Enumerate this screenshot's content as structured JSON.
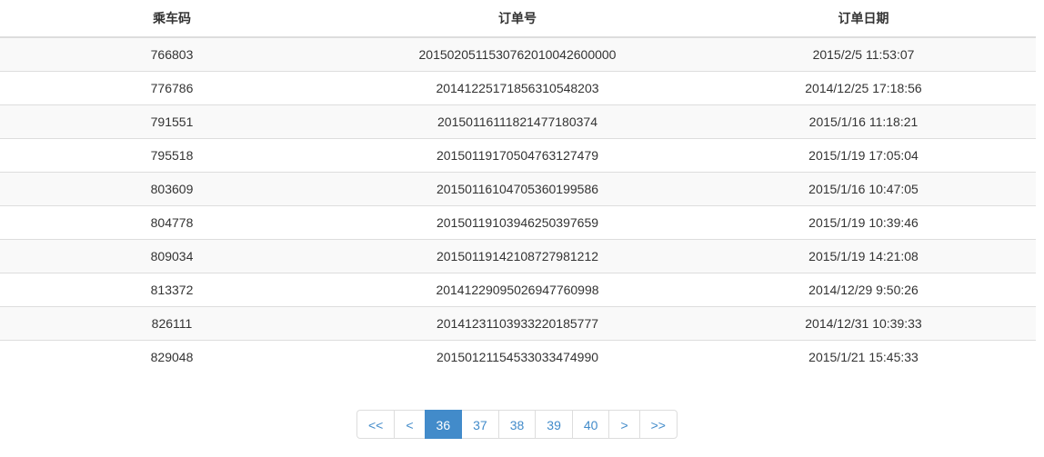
{
  "table": {
    "headers": [
      "乘车码",
      "订单号",
      "订单日期"
    ],
    "rows": [
      [
        "766803",
        "2015020511530762010042600000",
        "2015/2/5 11:53:07"
      ],
      [
        "776786",
        "2014122517185631054820​3",
        "2014/12/25 17:18:56"
      ],
      [
        "791551",
        "2015011611182147718037​4",
        "2015/1/16 11:18:21"
      ],
      [
        "795518",
        "2015011917050476312747​9",
        "2015/1/19 17:05:04"
      ],
      [
        "803609",
        "2015011610470536019958​6",
        "2015/1/16 10:47:05"
      ],
      [
        "804778",
        "2015011910394625039765​9",
        "2015/1/19 10:39:46"
      ],
      [
        "809034",
        "2015011914210872798121​2",
        "2015/1/19 14:21:08"
      ],
      [
        "813372",
        "2014122909502694776099​8",
        "2014/12/29 9:50:26"
      ],
      [
        "826111",
        "2014123110393322018577​7",
        "2014/12/31 10:39:33"
      ],
      [
        "829048",
        "2015012115453303347499​0",
        "2015/1/21 15:45:33"
      ]
    ]
  },
  "pagination": {
    "items": [
      "<<",
      "<",
      "36",
      "37",
      "38",
      "39",
      "40",
      ">",
      ">>"
    ],
    "active": "36"
  },
  "colors": {
    "accent": "#428bca",
    "stripe": "#f9f9f9",
    "border": "#dddddd",
    "text": "#333333"
  }
}
